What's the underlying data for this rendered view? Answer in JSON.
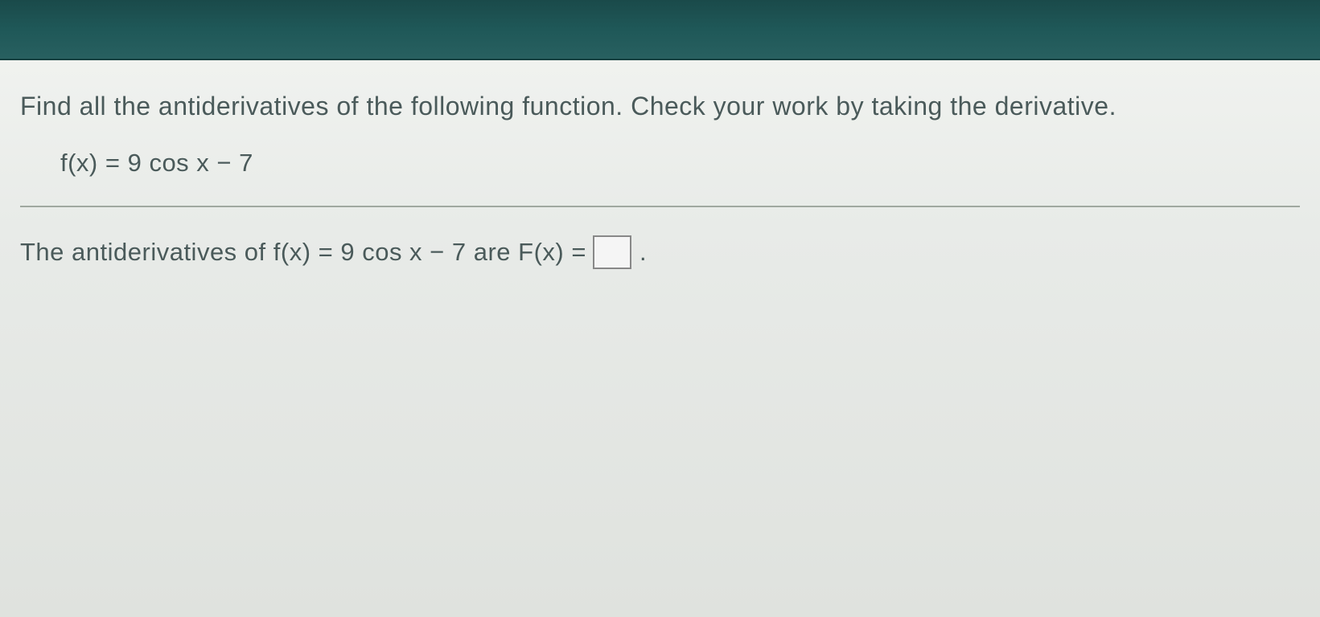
{
  "instruction": "Find all the antiderivatives of the following function. Check your work by taking the derivative.",
  "function": "f(x) = 9 cos x − 7",
  "answer": {
    "prefix": "The antiderivatives of f(x) = 9 cos x − 7 are F(x) =",
    "input_value": "",
    "suffix": "."
  }
}
